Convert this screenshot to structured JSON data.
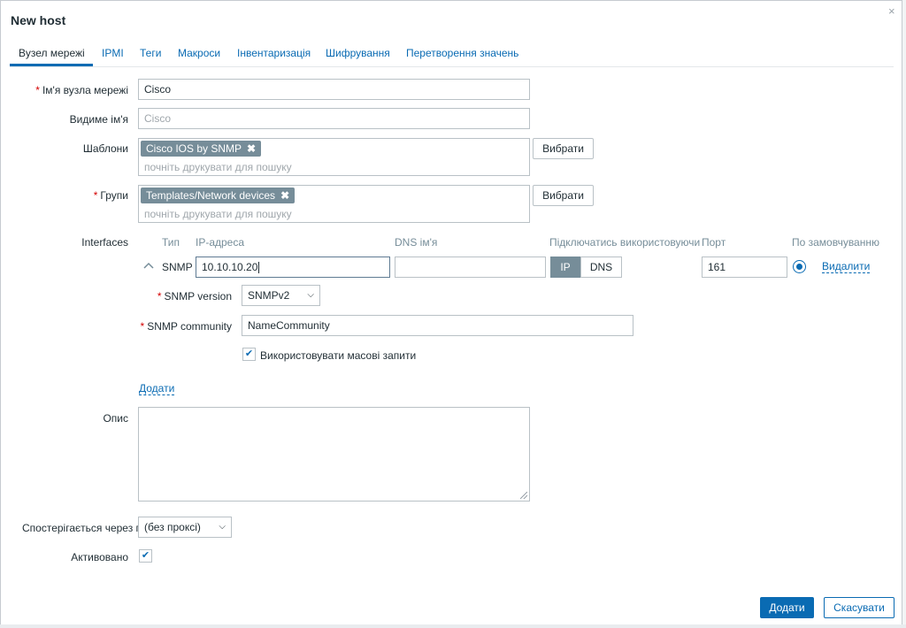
{
  "dialog": {
    "title": "New host",
    "close_glyph": "×"
  },
  "tabs": [
    {
      "label": "Вузел мережі",
      "active": true
    },
    {
      "label": "IPMI"
    },
    {
      "label": "Теги"
    },
    {
      "label": "Макроси"
    },
    {
      "label": "Інвентаризація"
    },
    {
      "label": "Шифрування"
    },
    {
      "label": "Перетворення значень"
    }
  ],
  "form": {
    "required_mark": "*",
    "hostname": {
      "label": "Ім'я вузла мережі",
      "value": "Cisco"
    },
    "visible_name": {
      "label": "Видиме ім'я",
      "placeholder": "Cisco"
    },
    "templates": {
      "label": "Шаблони",
      "chip": "Cisco IOS by SNMP",
      "placeholder": "почніть друкувати для пошуку",
      "button": "Вибрати"
    },
    "groups": {
      "label": "Групи",
      "chip": "Templates/Network devices",
      "placeholder": "почніть друкувати для пошуку",
      "button": "Вибрати"
    },
    "interfaces": {
      "label": "Interfaces",
      "headers": {
        "type": "Тип",
        "ip": "IP-адреса",
        "dns": "DNS ім'я",
        "connect": "Підключатись використовуючи",
        "port": "Порт",
        "default": "По замовчуванню"
      },
      "row": {
        "type": "SNMP",
        "ip": "10.10.10.20",
        "dns": "",
        "connect_options": [
          "IP",
          "DNS"
        ],
        "connect_selected": "IP",
        "port": "161",
        "remove": "Видалити",
        "default_selected": true
      },
      "snmp_version": {
        "label": "SNMP version",
        "value": "SNMPv2"
      },
      "snmp_community": {
        "label": "SNMP community",
        "value": "NameCommunity"
      },
      "bulk": {
        "label": "Використовувати масові запити",
        "checked": true
      },
      "add_link": "Додати"
    },
    "description": {
      "label": "Опис",
      "value": ""
    },
    "monitored_by": {
      "label": "Спостерігається через п",
      "value": "(без проксі)"
    },
    "enabled": {
      "label": "Активовано",
      "checked": true
    }
  },
  "footer": {
    "add": "Додати",
    "cancel": "Скасувати"
  },
  "icons": {
    "check": "✔",
    "chip_remove": "✖",
    "chevron_down": "⌵"
  },
  "colors": {
    "accent": "#0a6bb3",
    "chip": "#768d99",
    "required": "#d40000"
  }
}
